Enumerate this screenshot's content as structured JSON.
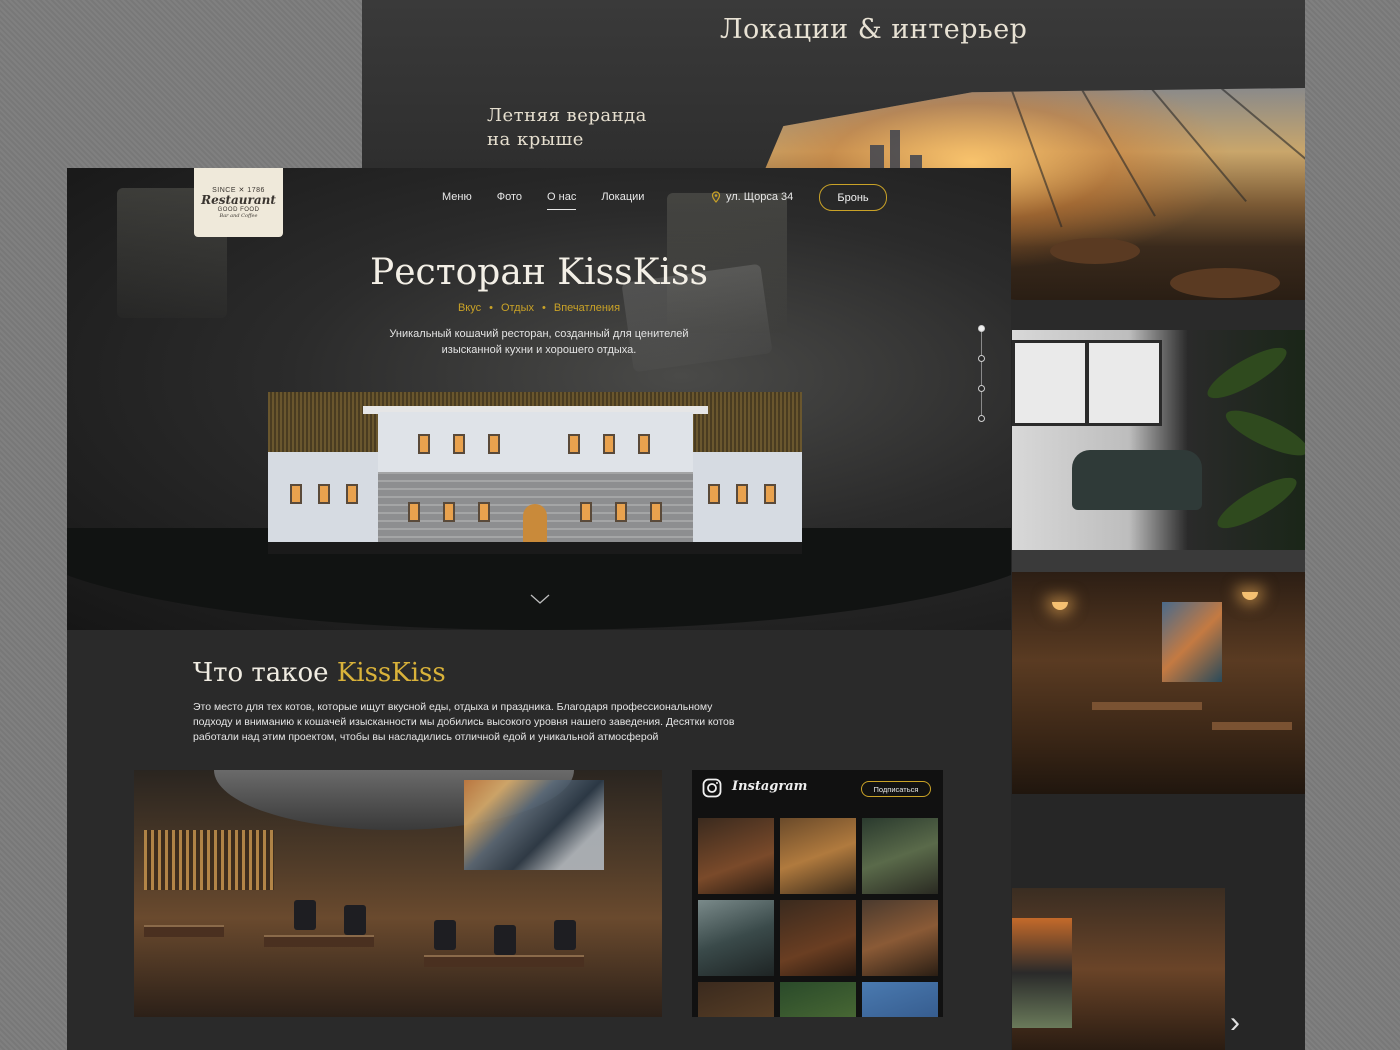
{
  "back_page": {
    "title": "Локации & интерьер",
    "veranda_line1": "Летняя веранда",
    "veranda_line2": "на крыше",
    "next_arrow": "›"
  },
  "header": {
    "logo": {
      "since": "SINCE",
      "year": "1786",
      "name": "Restaurant",
      "tagline": "GOOD FOOD",
      "sub": "Bar and Coffee"
    },
    "nav": [
      {
        "label": "Меню",
        "active": false
      },
      {
        "label": "Фото",
        "active": false
      },
      {
        "label": "О нас",
        "active": true
      },
      {
        "label": "Локации",
        "active": false
      }
    ],
    "address": "ул. Щорса 34",
    "book_button": "Бронь"
  },
  "hero": {
    "title": "Ресторан KissKiss",
    "tags": [
      "Вкус",
      "Отдых",
      "Впечатления"
    ],
    "description": "Уникальный кошачий ресторан, созданный для ценителей изысканной кухни и хорошего отдыха.",
    "slider_active_index": 0,
    "slider_count": 4
  },
  "about": {
    "title_plain": "Что такое ",
    "title_accent": "KissKiss",
    "text": "Это место для тех котов, которые ищут вкусной еды, отдыха и праздника. Благодаря профессиональному подходу и вниманию к кошачей изысканности мы добились высокого уровня нашего заведения. Десятки котов работали над этим проектом, чтобы вы насладились отличной едой и уникальной атмосферой"
  },
  "instagram": {
    "name": "Instagram",
    "subscribe_label": "Подписаться"
  },
  "colors": {
    "accent": "#c9a227",
    "background": "#2a2a2a",
    "text": "#e8e8e8"
  }
}
